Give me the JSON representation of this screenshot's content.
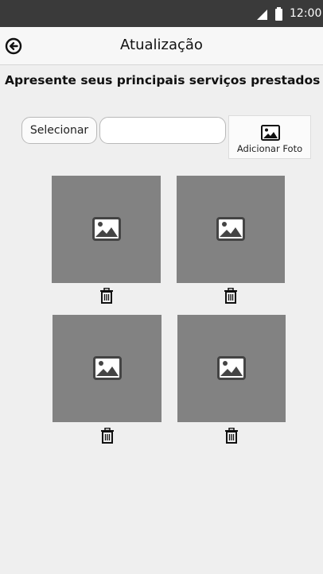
{
  "status_bar": {
    "time": "12:00",
    "icons": [
      "signal-icon",
      "battery-icon"
    ]
  },
  "header": {
    "title": "Atualização",
    "back_icon": "back-arrow-icon"
  },
  "main": {
    "heading": "Apresente seus principais serviços prestados",
    "select_button_label": "Selecionar",
    "file_input_value": "",
    "add_photo_label": "Adicionar Foto",
    "add_photo_icon": "image-icon"
  },
  "gallery": {
    "items": [
      {
        "icon": "image-placeholder-icon",
        "delete_icon": "trash-icon"
      },
      {
        "icon": "image-placeholder-icon",
        "delete_icon": "trash-icon"
      },
      {
        "icon": "image-placeholder-icon",
        "delete_icon": "trash-icon"
      },
      {
        "icon": "image-placeholder-icon",
        "delete_icon": "trash-icon"
      }
    ]
  },
  "colors": {
    "status_bar": "#3a3a3a",
    "app_bar": "#f7f7f7",
    "background": "#efefef",
    "thumbnail": "#828282"
  }
}
